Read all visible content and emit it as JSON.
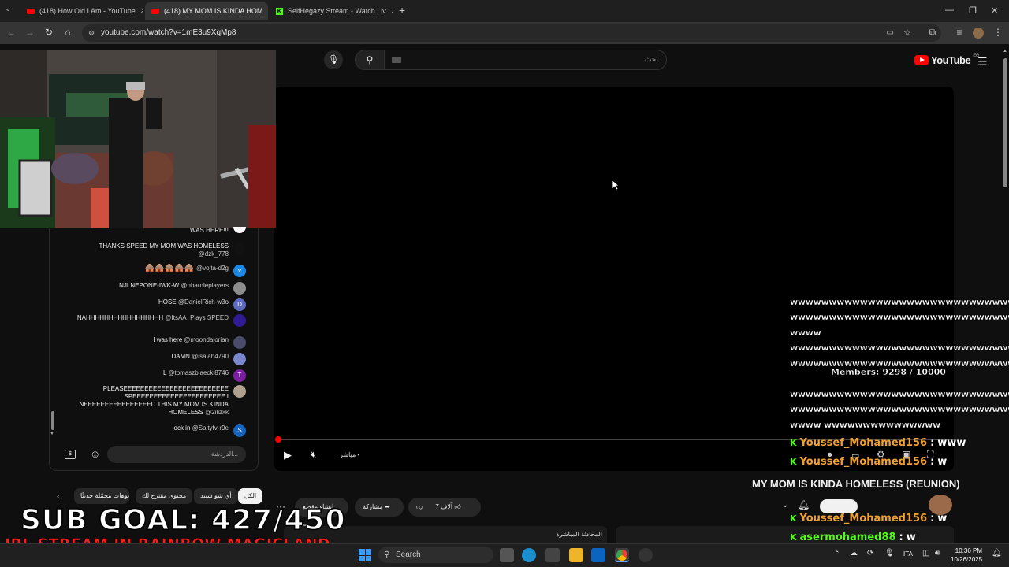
{
  "browser": {
    "tabs": [
      {
        "label": "(418) How Old I Am - YouTube",
        "icon": "youtube-icon"
      },
      {
        "label": "(418) MY MOM IS KINDA HOM",
        "icon": "youtube-icon"
      },
      {
        "label": "SeifHegazy Stream - Watch Liv",
        "icon": "kick-icon"
      }
    ],
    "url": "youtube.com/watch?v=1mE3u9XqMp8"
  },
  "youtube": {
    "search_placeholder": "بحث",
    "logo_text": "YouTube",
    "logo_region": "EG",
    "live_label": "مباشر •",
    "video_title": "MY MOM IS KINDA HOMELESS (REUNION)"
  },
  "chat": {
    "messages": [
      {
        "text": "WAS HERE!!!",
        "user": "",
        "avatar_color": "#ffffff",
        "avatar_letter": ""
      },
      {
        "text": "THANKS SPEED MY MOM WAS HOMELESS",
        "user": "@dzk_778",
        "avatar_color": "#111111",
        "avatar_letter": ""
      },
      {
        "text": "🛖🛖🛖🛖🛖",
        "user": "@vojta-d2g",
        "avatar_color": "#1e88e5",
        "avatar_letter": "v"
      },
      {
        "text": "NJLNEPONE-IWK-W",
        "user": "@nbaroleplayers",
        "avatar_color": "#8d8d8d",
        "avatar_letter": ""
      },
      {
        "text": "HOSE",
        "user": "@DanielRich-w3o",
        "avatar_color": "#5c6bc0",
        "avatar_letter": "D"
      },
      {
        "text": "NAHHHHHHHHHHHHHHHHH",
        "user": "@ItsAA_Plays SPEED",
        "avatar_color": "#311b92",
        "avatar_letter": ""
      },
      {
        "text": "I was here",
        "user": "@moondalorian",
        "avatar_color": "#4a4a6a",
        "avatar_letter": ""
      },
      {
        "text": "DAMN",
        "user": "@isaiah4790",
        "avatar_color": "#7986cb",
        "avatar_letter": ""
      },
      {
        "text": "L",
        "user": "@tomaszbiaecki8746",
        "avatar_color": "#7b1fa2",
        "avatar_letter": "T"
      },
      {
        "text": "PLEASEEEEEEEEEEEEEEEEEEEEEEEEE SPEEEEEEEEEEEEEEEEEEEEEE I NEEEEEEEEEEEEEEEED THIS MY MOM IS KINDA HOMELESS",
        "user": "@2ilizxk",
        "avatar_color": "#b0a090",
        "avatar_letter": ""
      },
      {
        "text": "lock in",
        "user": "@Saltyfv-r9e",
        "avatar_color": "#1565c0",
        "avatar_letter": "S"
      }
    ],
    "input_placeholder": "الدردشة..."
  },
  "chips": [
    "الكل",
    "أي شو سبيد",
    "محتوى مقترح لك",
    "فيديوهات محمّلة حديثًا"
  ],
  "actions": {
    "like_count": "7 آلاف",
    "share": "مشاركة",
    "clip": "إنشاء مقطع"
  },
  "stream_overlay": {
    "sub_goal": "SUB GOAL: 427/450",
    "banner": "IRL STREAM IN RAINBOW MAGICLAND",
    "members": "Members: 9298 / 10000",
    "w_lines": [
      "wwwwwwwwwwwwwwwwwwwwwwwwwwwwwwwwww",
      "wwwwwwwwwwwwwwwwwwwwwwwwwwwwwwwwww",
      "wwww",
      "wwwwwwwwwwwwwwwwwwwwwwwwwwwwwwwwww",
      "wwwwwwwwwwwwwwwwwwwwwwwwwwwwwwwwww",
      "wwwwwwwwwwwwwwwwwwwwwwwwwwwwwwwwww",
      "wwwwwwwwwwwwwwwwwwwwwwwwwwwwwwwwww",
      "wwww wwwwwwwwwwwwwww"
    ],
    "kick_chat": [
      {
        "user": "Youssef_Mohamed156",
        "msg": "www",
        "color": "#f0a030"
      },
      {
        "user": "Youssef_Mohamed156",
        "msg": "w",
        "color": "#f0a030"
      },
      {
        "user": "Youssef_Mohamed156",
        "msg": "w",
        "color": "#f0a030"
      },
      {
        "user": "asermohamed88",
        "msg": "w",
        "color": "#53fc18"
      }
    ]
  },
  "taskbar": {
    "search_placeholder": "Search",
    "lang": "ITA",
    "time": "10:36 PM",
    "date": "10/26/2025"
  },
  "colors": {
    "kick_green": "#53fc18",
    "yt_red": "#ff0000"
  }
}
